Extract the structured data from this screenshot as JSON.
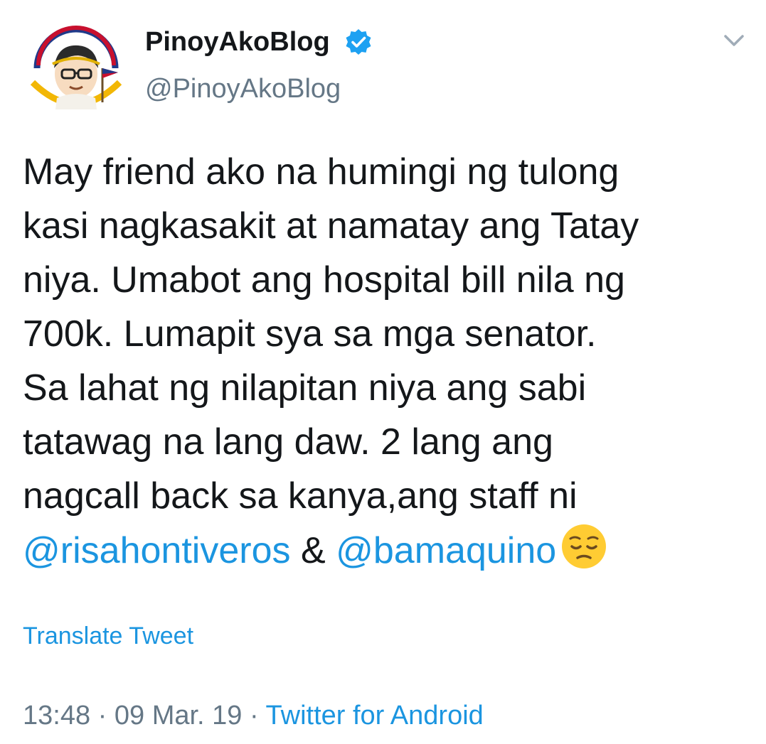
{
  "author": {
    "display_name": "PinoyAkoBlog",
    "handle": "@PinoyAkoBlog",
    "verified": true,
    "avatar_icon": "cartoon-avatar-with-flag"
  },
  "header": {
    "menu_icon": "chevron-down-icon"
  },
  "tweet": {
    "lines": [
      "May friend ako na humingi ng tulong",
      "kasi nagkasakit at namatay ang Tatay",
      "niya. Umabot ang hospital bill nila ng",
      "700k. Lumapit sya sa mga senator.",
      "Sa lahat ng nilapitan niya ang sabi",
      "tatawag na lang daw. 2 lang ang",
      "nagcall back sa kanya,ang staff ni"
    ],
    "mention_1": "@risahontiveros",
    "ampersand": " & ",
    "mention_2": "@bamaquino",
    "emoji": "pensive-face-emoji"
  },
  "actions": {
    "translate_label": "Translate Tweet"
  },
  "meta": {
    "time": "13:48",
    "separator_1": " · ",
    "date": "09 Mar. 19",
    "separator_2": " · ",
    "source": "Twitter for Android"
  },
  "colors": {
    "link": "#1b95e0",
    "secondary_text": "#657786",
    "primary_text": "#14171a",
    "verified_badge": "#1da1f2"
  }
}
